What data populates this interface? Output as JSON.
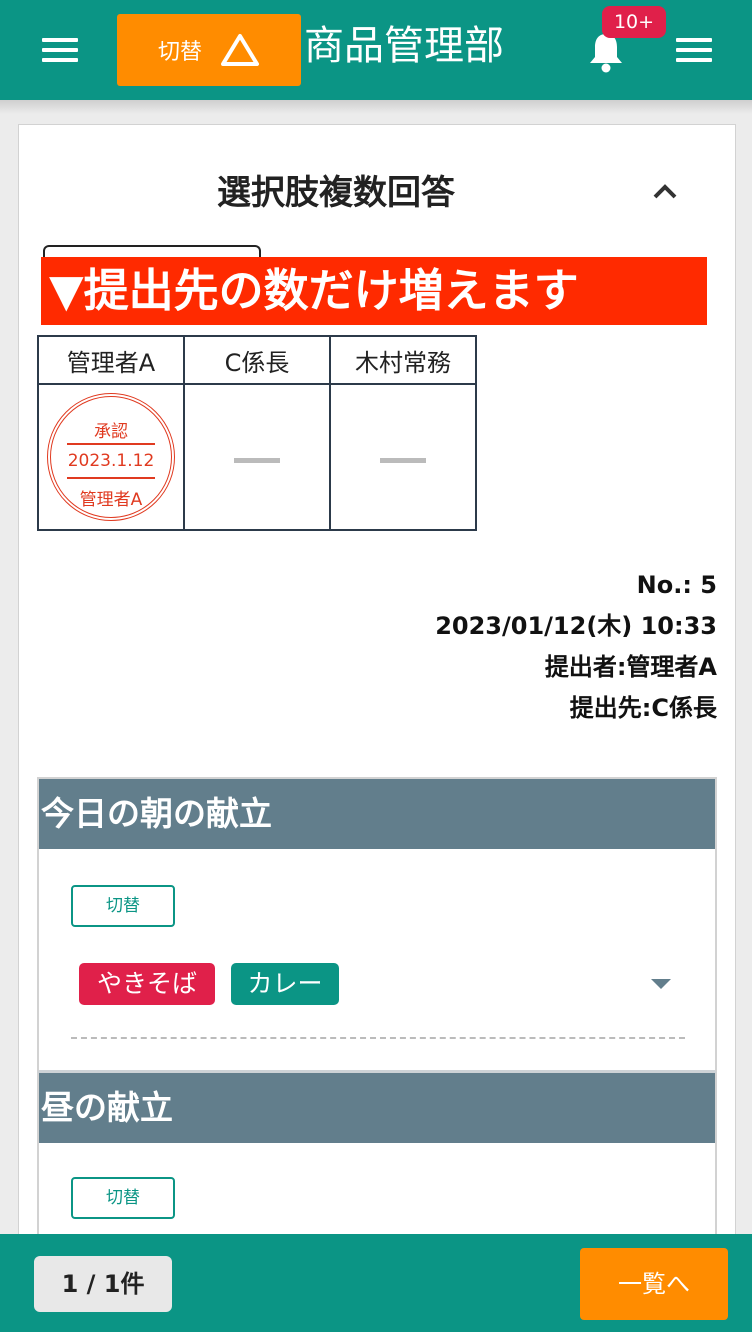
{
  "header": {
    "switch_label": "切替",
    "department": "商品管理部",
    "notification_badge": "10+"
  },
  "card": {
    "title": "選択肢複数回答",
    "banner": "▼提出先の数だけ増えます",
    "approvers": [
      "管理者A",
      "C係長",
      "木村常務"
    ],
    "stamp": {
      "top": "承認",
      "date": "2023.1.12",
      "bottom": "管理者A"
    },
    "meta": {
      "number": "No.: 5",
      "datetime": "2023/01/12(木) 10:33",
      "submitter": "提出者:管理者A",
      "recipient": "提出先:C係長"
    }
  },
  "sections": [
    {
      "title": "今日の朝の献立",
      "switch_label": "切替",
      "tags": [
        "やきそば",
        "カレー"
      ]
    },
    {
      "title": "昼の献立",
      "switch_label": "切替"
    }
  ],
  "footer": {
    "pager": "1 / 1件",
    "list_button": "一覧へ"
  },
  "colors": {
    "primary": "#0b9585",
    "accent": "#ff8c00",
    "banner": "#ff2a00",
    "section_header": "#627e8c",
    "tag_red": "#e0204a",
    "stamp": "#e03a20"
  },
  "icons": [
    "menu-icon",
    "warning-triangle-icon",
    "bell-icon",
    "chevron-up-icon",
    "caret-down-icon"
  ]
}
